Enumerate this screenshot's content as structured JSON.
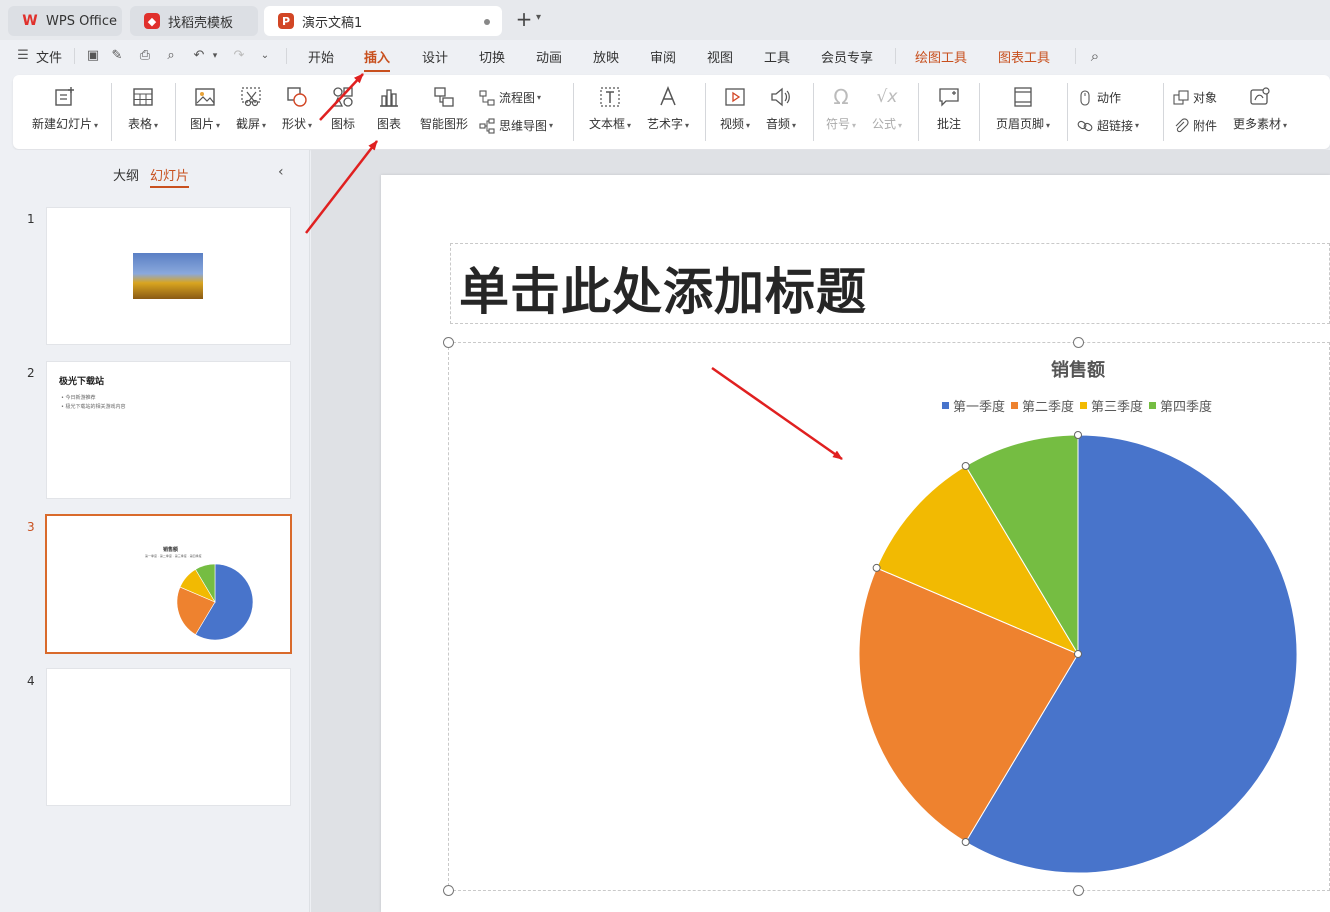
{
  "tabs": {
    "wps": "WPS Office",
    "template": "找稻壳模板",
    "document": "演示文稿1"
  },
  "menu": {
    "file": "文件",
    "items": [
      "开始",
      "插入",
      "设计",
      "切换",
      "动画",
      "放映",
      "审阅",
      "视图",
      "工具",
      "会员专享"
    ],
    "active": "插入",
    "context_tools": [
      "绘图工具",
      "图表工具"
    ]
  },
  "ribbon": {
    "new_slide": "新建幻灯片",
    "table": "表格",
    "picture": "图片",
    "screenshot": "截屏",
    "shape": "形状",
    "icon": "图标",
    "chart": "图表",
    "smart_graphic": "智能图形",
    "flowchart": "流程图",
    "mindmap": "思维导图",
    "textbox": "文本框",
    "wordart": "艺术字",
    "video": "视频",
    "audio": "音频",
    "symbol": "符号",
    "formula": "公式",
    "comment": "批注",
    "header_footer": "页眉页脚",
    "action": "动作",
    "hyperlink": "超链接",
    "object": "对象",
    "attachment": "附件",
    "more_assets": "更多素材"
  },
  "panel": {
    "outline_tab": "大纲",
    "slides_tab": "幻灯片",
    "selected_slide": 3,
    "slide2_title": "极光下载站",
    "slide2_bullets": [
      "今日新游推荐",
      "极光下载站的相关游戏内容"
    ],
    "slide3_title": "销售额",
    "slide3_legend": "第一季度 · 第二季度 · 第三季度 · 第四季度"
  },
  "slide": {
    "title_placeholder": "单击此处添加标题"
  },
  "chart_data": {
    "type": "pie",
    "title": "销售额",
    "categories": [
      "第一季度",
      "第二季度",
      "第三季度",
      "第四季度"
    ],
    "values": [
      8.2,
      3.2,
      1.4,
      1.2
    ],
    "colors": [
      "#4874cb",
      "#ee822f",
      "#f2ba02",
      "#75bd42"
    ],
    "legend_position": "top"
  },
  "colors": {
    "accent": "#c8501e",
    "annotation_arrow": "#e02020"
  }
}
